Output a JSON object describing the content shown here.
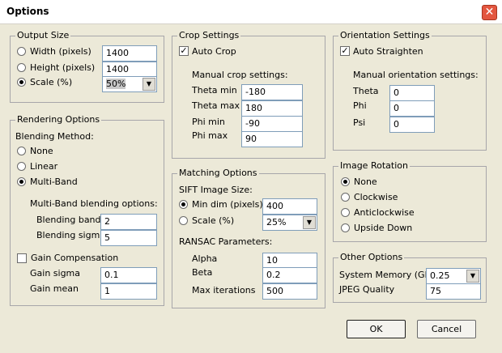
{
  "window": {
    "title": "Options",
    "close": "✕"
  },
  "output": {
    "title": "Output Size",
    "width_label": "Width (pixels)",
    "width_value": "1400",
    "height_label": "Height (pixels)",
    "height_value": "1400",
    "scale_label": "Scale (%)",
    "scale_value": "50%"
  },
  "rendering": {
    "title": "Rendering Options",
    "blending_method": "Blending Method:",
    "none": "None",
    "linear": "Linear",
    "multiband": "Multi-Band",
    "mb_options": "Multi-Band blending options:",
    "bands_label": "Blending bands",
    "bands_value": "2",
    "sigma_label": "Blending sigma",
    "sigma_value": "5",
    "gain_comp": "Gain Compensation",
    "gain_sigma_label": "Gain sigma",
    "gain_sigma_value": "0.1",
    "gain_mean_label": "Gain mean",
    "gain_mean_value": "1"
  },
  "crop": {
    "title": "Crop Settings",
    "auto": "Auto Crop",
    "manual": "Manual crop settings:",
    "theta_min_label": "Theta min",
    "theta_min": "-180",
    "theta_max_label": "Theta max",
    "theta_max": "180",
    "phi_min_label": "Phi min",
    "phi_min": "-90",
    "phi_max_label": "Phi max",
    "phi_max": "90"
  },
  "matching": {
    "title": "Matching Options",
    "sift": "SIFT Image Size:",
    "mindim_label": "Min dim (pixels)",
    "mindim_value": "400",
    "scale_label": "Scale (%)",
    "scale_value": "25%",
    "ransac": "RANSAC Parameters:",
    "alpha_label": "Alpha",
    "alpha_value": "10",
    "beta_label": "Beta",
    "beta_value": "0.2",
    "maxit_label": "Max iterations",
    "maxit_value": "500"
  },
  "orientation": {
    "title": "Orientation Settings",
    "auto": "Auto Straighten",
    "manual": "Manual orientation settings:",
    "theta_label": "Theta",
    "theta_value": "0",
    "phi_label": "Phi",
    "phi_value": "0",
    "psi_label": "Psi",
    "psi_value": "0"
  },
  "rotation": {
    "title": "Image Rotation",
    "none": "None",
    "cw": "Clockwise",
    "ccw": "Anticlockwise",
    "ud": "Upside Down"
  },
  "other": {
    "title": "Other Options",
    "mem_label": "System Memory (Gb)",
    "mem_value": "0.25",
    "jpeg_label": "JPEG Quality",
    "jpeg_value": "75"
  },
  "buttons": {
    "ok": "OK",
    "cancel": "Cancel"
  },
  "icons": {
    "dropdown": "▼",
    "check": "✓"
  }
}
